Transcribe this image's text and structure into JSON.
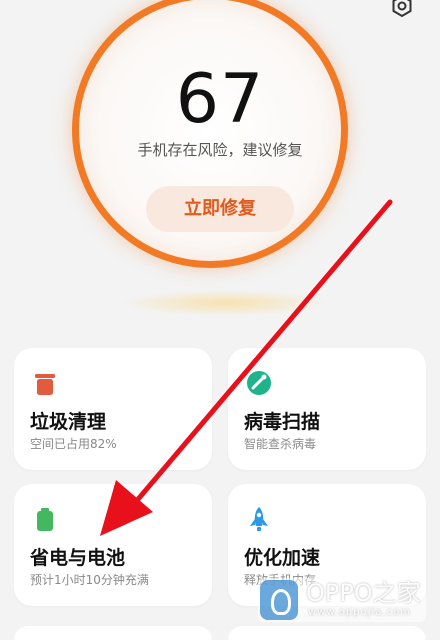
{
  "score": {
    "value": "67",
    "description": "手机存在风险，建议修复",
    "action_label": "立即修复"
  },
  "cards": [
    {
      "title": "垃圾清理",
      "subtitle": "空间已占用82%",
      "icon": "trash-icon",
      "color": "#e35b3e"
    },
    {
      "title": "病毒扫描",
      "subtitle": "智能查杀病毒",
      "icon": "shield-scan-icon",
      "color": "#1fb38b"
    },
    {
      "title": "省电与电池",
      "subtitle": "预计1小时10分钟充满",
      "icon": "battery-icon",
      "color": "#43b860"
    },
    {
      "title": "优化加速",
      "subtitle": "释放手机内存",
      "icon": "rocket-icon",
      "color": "#2a9ae8"
    }
  ],
  "watermark": {
    "text": "OPPO之家",
    "url": "www.oppojia.com"
  },
  "colors": {
    "accent": "#f27a25",
    "arrow": "#e8101a"
  }
}
